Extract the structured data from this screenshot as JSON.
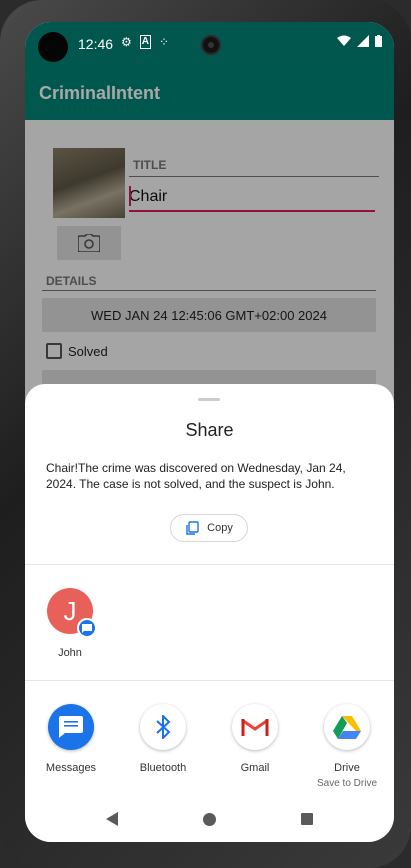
{
  "status_bar": {
    "time": "12:46"
  },
  "app": {
    "title": "CriminalIntent"
  },
  "crime_form": {
    "title_label": "TITLE",
    "title_value": "Chair",
    "details_label": "DETAILS",
    "date_button": "WED JAN 24 12:45:06 GMT+02:00 2024",
    "solved_label": "Solved",
    "solved_checked": false
  },
  "share_sheet": {
    "title": "Share",
    "text": "Chair!The crime was discovered on Wednesday, Jan 24, 2024. The case is not solved, and the suspect is John.",
    "copy_label": "Copy",
    "contact": {
      "initial": "J",
      "name": "John",
      "avatar_color": "#e8605a"
    },
    "apps": [
      {
        "name": "Messages",
        "sub": ""
      },
      {
        "name": "Bluetooth",
        "sub": ""
      },
      {
        "name": "Gmail",
        "sub": ""
      },
      {
        "name": "Drive",
        "sub": "Save to Drive"
      }
    ]
  },
  "colors": {
    "status_bar": "#01574d",
    "app_bar": "#008577",
    "accent": "#d81b60"
  }
}
